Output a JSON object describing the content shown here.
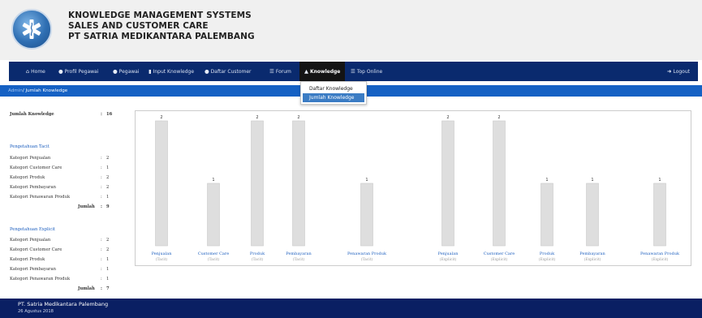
{
  "header": {
    "title_line1": "KNOWLEDGE MANAGEMENT SYSTEMS",
    "title_line2": "SALES AND CUSTOMER CARE",
    "title_line3": "PT SATRIA MEDIKANTARA PALEMBANG"
  },
  "nav": {
    "home": "Home",
    "profil": "Profil Pegawai",
    "pegawai": "Pegawai",
    "input": "Input Knowledge",
    "daftar_customer": "Daftar Customer",
    "forum": "Forum",
    "knowledge": "Knowledge",
    "top_online": "Top Online",
    "logout": "Logout"
  },
  "dropdown": {
    "item1": "Daftar Knowledge",
    "item2": "Jumlah Knowledge"
  },
  "breadcrumb": {
    "root": "Admin",
    "current": "/ Jumlah Knowledge"
  },
  "stats": {
    "total_label": "Jumlah Knowledge",
    "total_value": "16",
    "tacit_title": "Pengetahuan Tacit",
    "tacit": [
      {
        "label": "Kategori Penjualan",
        "value": "2"
      },
      {
        "label": "Kategori Customer Care",
        "value": "1"
      },
      {
        "label": "Kategori Produk",
        "value": "2"
      },
      {
        "label": "Kategori Pembayaran",
        "value": "2"
      },
      {
        "label": "Kategori Penawaran Produk",
        "value": "1"
      }
    ],
    "tacit_sum_label": "Jumlah",
    "tacit_sum_value": "9",
    "explicit_title": "Pengetahuan Explicit",
    "explicit": [
      {
        "label": "Kategori Penjualan",
        "value": "2"
      },
      {
        "label": "Kategori Customer Care",
        "value": "2"
      },
      {
        "label": "Kategori Produk",
        "value": "1"
      },
      {
        "label": "Kategori Pembayaran",
        "value": "1"
      },
      {
        "label": "Kategori Penawaran Produk",
        "value": "1"
      }
    ],
    "explicit_sum_label": "Jumlah",
    "explicit_sum_value": "7"
  },
  "chart_data": {
    "type": "bar",
    "ylim": [
      0,
      2
    ],
    "bars": [
      {
        "label": "Penjualan",
        "sub": "(Tacit)",
        "value": 2
      },
      {
        "label": "Customer Care",
        "sub": "(Tacit)",
        "value": 1
      },
      {
        "label": "Produk",
        "sub": "(Tacit)",
        "value": 2
      },
      {
        "label": "Pembayaran",
        "sub": "(Tacit)",
        "value": 2
      },
      {
        "label": "Penawaran Produk",
        "sub": "(Tacit)",
        "value": 1
      },
      {
        "label": "Penjualan",
        "sub": "(Explicit)",
        "value": 2
      },
      {
        "label": "Customer Care",
        "sub": "(Explicit)",
        "value": 2
      },
      {
        "label": "Produk",
        "sub": "(Explicit)",
        "value": 1
      },
      {
        "label": "Pembayaran",
        "sub": "(Explicit)",
        "value": 1
      },
      {
        "label": "Penawaran Produk",
        "sub": "(Explicit)",
        "value": 1
      }
    ],
    "bar_color": "#dedede",
    "label_color": "#1d5fbf",
    "sub_color": "#9a9a9a"
  },
  "footer": {
    "company": "PT. Satria Medikantara Palembang",
    "date": "26 Agustus 2018"
  },
  "colors": {
    "navbar": "#0a2a6e",
    "breadcrumb": "#1561c4",
    "footer": "#0a1f63",
    "dropdown_active": "#3b7cc4"
  }
}
